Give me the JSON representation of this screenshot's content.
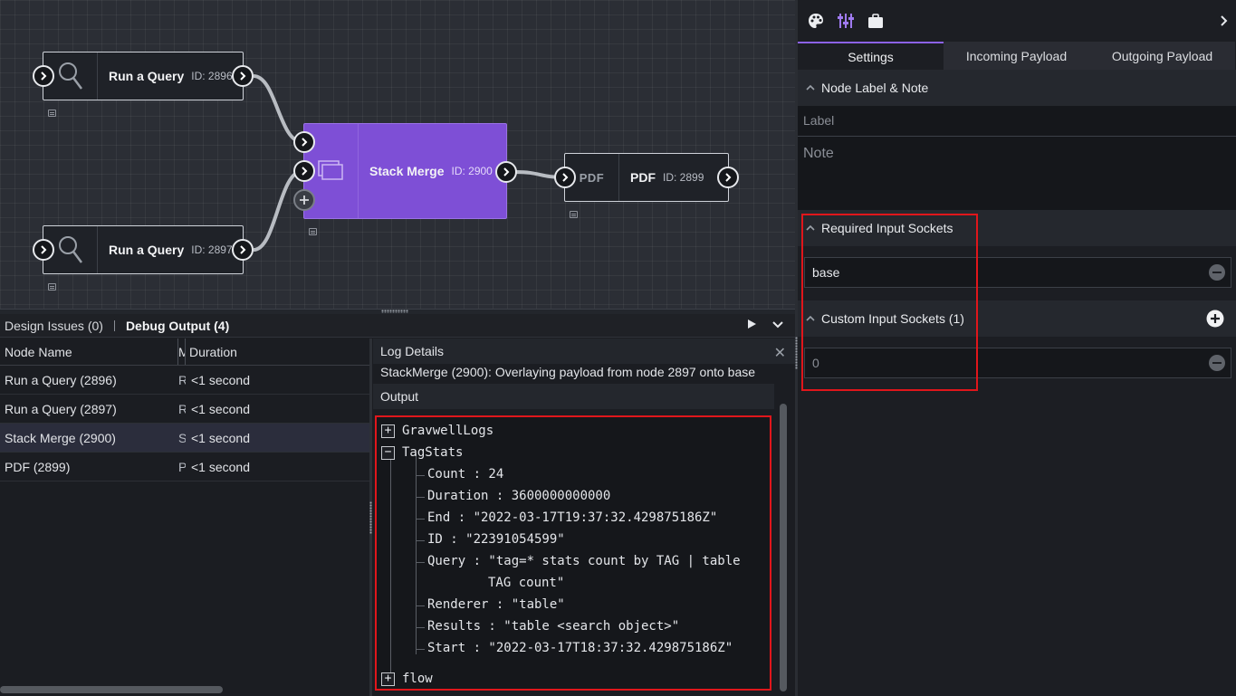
{
  "canvas": {
    "nodes": [
      {
        "title": "Run a Query",
        "id_label": "ID: 2896",
        "icon": "search-icon"
      },
      {
        "title": "Run a Query",
        "id_label": "ID: 2897",
        "icon": "search-icon"
      },
      {
        "title": "Stack Merge",
        "id_label": "ID: 2900",
        "icon": "stack-icon"
      },
      {
        "title": "PDF",
        "id_label": "ID: 2899",
        "icon": "pdf-icon",
        "icon_text": "PDF"
      }
    ]
  },
  "bottom": {
    "tabs": [
      {
        "label": "Design Issues (0)",
        "active": false
      },
      {
        "label": "Debug Output (4)",
        "active": true
      }
    ],
    "grid": {
      "headers": [
        "Node Name",
        "Message",
        "Duration"
      ],
      "rows": [
        {
          "name": "Run a Query (2896)",
          "message": "R",
          "duration": "<1 second"
        },
        {
          "name": "Run a Query (2897)",
          "message": "R",
          "duration": "<1 second"
        },
        {
          "name": "Stack Merge (2900)",
          "message": "S",
          "duration": "<1 second",
          "selected": true
        },
        {
          "name": "PDF (2899)",
          "message": "P",
          "duration": "<1 second"
        }
      ]
    },
    "log": {
      "title": "Log Details",
      "message": "StackMerge (2900): Overlaying payload from node 2897 onto base",
      "output_label": "Output",
      "tree": {
        "gravwell": "GravwellLogs",
        "tagstats": "TagStats",
        "count": "Count : 24",
        "duration": "Duration : 3600000000000",
        "end": "End : \"2022-03-17T19:37:32.429875186Z\"",
        "id": "ID : \"22391054599\"",
        "query1": "Query : \"tag=* stats count by TAG | table",
        "query2": "TAG count\"",
        "renderer": "Renderer : \"table\"",
        "results": "Results : \"table <search object>\"",
        "start": "Start : \"2022-03-17T18:37:32.429875186Z\"",
        "flow": "flow"
      }
    }
  },
  "right": {
    "tabs": [
      "Settings",
      "Incoming Payload",
      "Outgoing Payload"
    ],
    "sections": {
      "label_note": "Node Label & Note",
      "label_placeholder": "Label",
      "note_placeholder": "Note",
      "required": "Required Input Sockets",
      "required_value": "base",
      "custom": "Custom Input Sockets (1)",
      "custom_value": "0"
    }
  },
  "colors": {
    "accent": "#8c62e8",
    "node_purple": "#7e4fd6",
    "highlight": "#e0161b"
  }
}
